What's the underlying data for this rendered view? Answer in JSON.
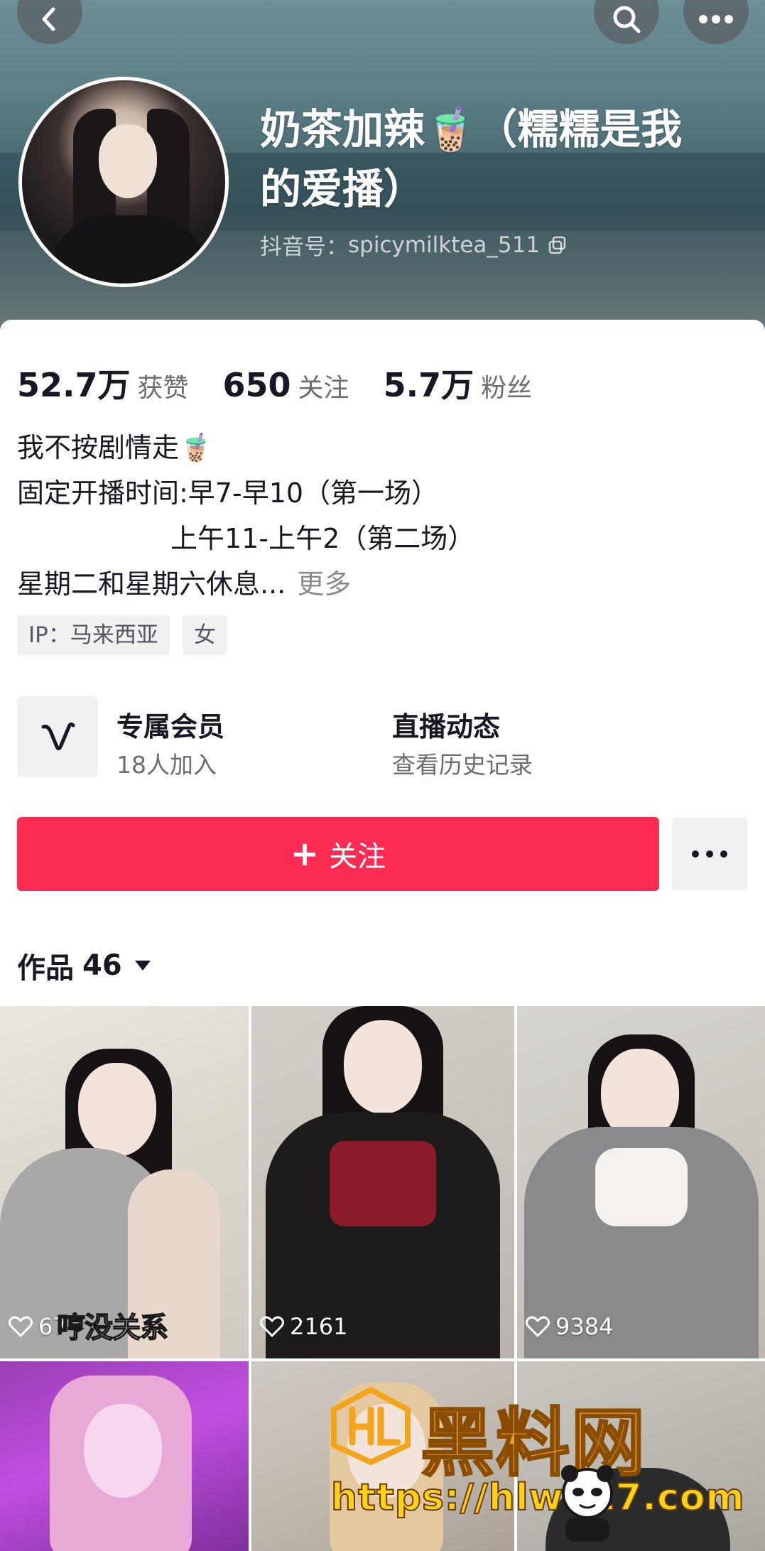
{
  "header": {
    "nickname_line1": "奶茶加辣🧋（糯糯是我",
    "nickname_line2": "的爱播）",
    "uid_label": "抖音号：",
    "uid": "spicymilktea_511"
  },
  "stats": [
    {
      "num": "52.7万",
      "label": "获赞"
    },
    {
      "num": "650",
      "label": "关注"
    },
    {
      "num": "5.7万",
      "label": "粉丝"
    }
  ],
  "bio": {
    "line1": "我不按剧情走🧋",
    "line2": "固定开播时间:早7-早10（第一场）",
    "line3": "上午11-上午2（第二场）",
    "line4": "星期二和星期六休息...",
    "more": "更多"
  },
  "tags": [
    "IP：马来西亚",
    "女"
  ],
  "entries": {
    "member_title": "专属会员",
    "member_sub": "18人加入",
    "live_title": "直播动态",
    "live_sub": "查看历史记录"
  },
  "actions": {
    "follow_label": "关注"
  },
  "works": {
    "label": "作品",
    "count": "46"
  },
  "videos": [
    {
      "likes": "67",
      "overlay": "哼没关系"
    },
    {
      "likes": "2161"
    },
    {
      "likes": "9384"
    }
  ],
  "watermark": {
    "title": "黑料网",
    "url": "https://hlwe17.com"
  },
  "colors": {
    "accent": "#fe2c55",
    "text": "#161823",
    "secondary": "#6b6d75",
    "chip_bg": "#f1f1f2",
    "watermark": "#f2a51c"
  },
  "icons": [
    "back-icon",
    "search-icon",
    "more-icon",
    "copy-icon",
    "vip-icon",
    "plus-icon",
    "dropdown-icon",
    "heart-icon"
  ]
}
